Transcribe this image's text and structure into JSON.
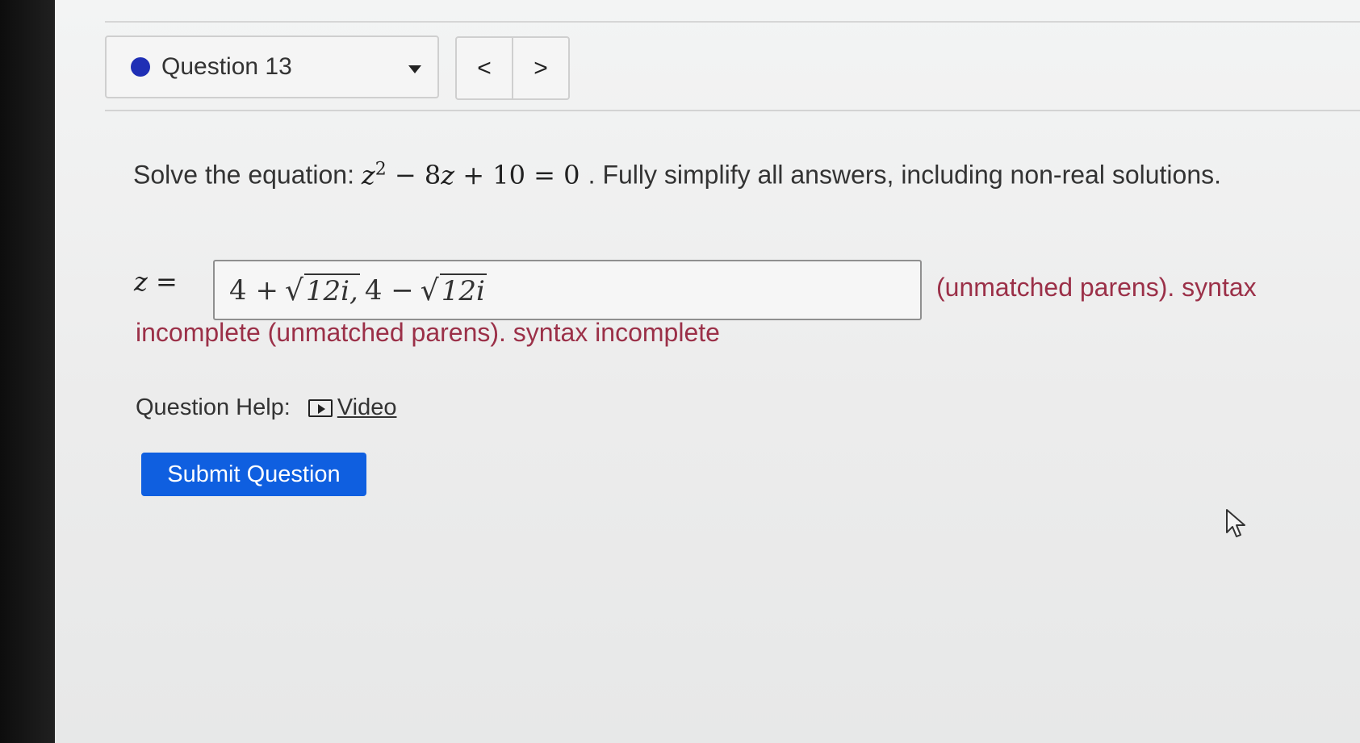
{
  "question_selector": {
    "label": "Question 13"
  },
  "nav": {
    "prev": "<",
    "next": ">"
  },
  "prompt": {
    "lead": "Solve the equation:",
    "equation": {
      "base": "z",
      "exp": "2",
      "rest_a": "− 8",
      "var": "z",
      "rest_b": "+ 10 = 0"
    },
    "tail": ". Fully simplify all answers, including non-real solutions."
  },
  "answer": {
    "label": "z =",
    "part1": "4 +",
    "rad1": "12i,",
    "part2": "4 −",
    "rad2": "12i"
  },
  "error": {
    "line1": "(unmatched parens). syntax",
    "line2": "incomplete (unmatched parens). syntax incomplete"
  },
  "help": {
    "label": "Question Help:",
    "video": "Video"
  },
  "submit": {
    "label": "Submit Question"
  },
  "colors": {
    "accent_blue": "#0f5fe0",
    "error_red": "#9b3048",
    "dot_blue": "#1f2fb5"
  }
}
